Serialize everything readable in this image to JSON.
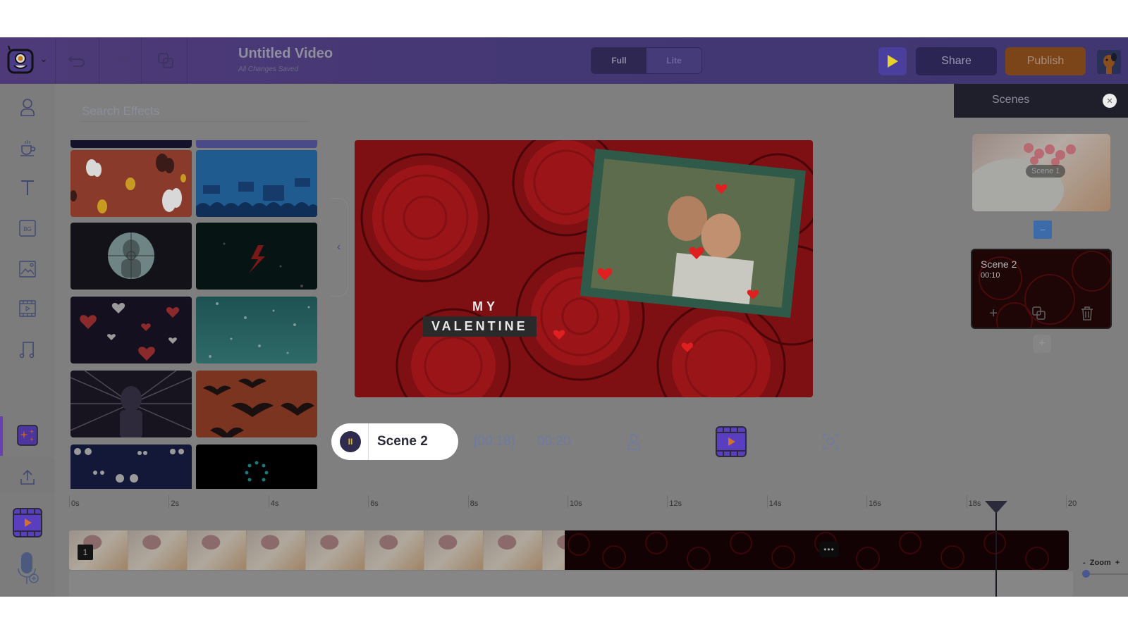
{
  "header": {
    "title": "Untitled Video",
    "subtitle": "All Changes Saved",
    "mode_options": [
      "Full",
      "Lite"
    ],
    "mode_selected": "Full",
    "share_label": "Share",
    "publish_label": "Publish"
  },
  "sidebar": {
    "items": [
      {
        "name": "characters",
        "icon": "character-icon"
      },
      {
        "name": "props",
        "icon": "coffee-cup-icon"
      },
      {
        "name": "text",
        "icon": "text-icon"
      },
      {
        "name": "backgrounds",
        "icon": "bg-icon",
        "glyph": "BG"
      },
      {
        "name": "images",
        "icon": "image-icon"
      },
      {
        "name": "videos",
        "icon": "video-icon"
      },
      {
        "name": "music",
        "icon": "music-icon"
      },
      {
        "name": "effects",
        "icon": "sparkles-icon",
        "active": true
      },
      {
        "name": "upload",
        "icon": "upload-icon"
      },
      {
        "name": "more",
        "icon": "grid-icon"
      }
    ]
  },
  "effects_panel": {
    "search_placeholder": "Search Effects",
    "tiles": [
      {
        "name": "dark-strip",
        "theme": "dark-navy"
      },
      {
        "name": "protest-hands",
        "theme": "purple-crowd"
      },
      {
        "name": "butterflies",
        "theme": "orange-butterflies"
      },
      {
        "name": "protest-crowd",
        "theme": "blue-crowd"
      },
      {
        "name": "scope-target",
        "theme": "dark-scope"
      },
      {
        "name": "lightning",
        "theme": "dark-teal-bolt"
      },
      {
        "name": "hearts",
        "theme": "dark-hearts"
      },
      {
        "name": "snow",
        "theme": "teal-snow"
      },
      {
        "name": "shock-burst",
        "theme": "dark-burst"
      },
      {
        "name": "bats",
        "theme": "orange-bats"
      },
      {
        "name": "eyes",
        "theme": "navy-eyes"
      },
      {
        "name": "loading-spinner",
        "theme": "black-spinner"
      }
    ]
  },
  "canvas": {
    "text_line1": "MY",
    "text_line2": "VALENTINE"
  },
  "player": {
    "scene_label": "Scene 2",
    "current_time": "[00:18]",
    "total_time": "00:20"
  },
  "scenes_panel": {
    "title": "Scenes",
    "scenes": [
      {
        "label": "Scene 1"
      },
      {
        "label": "Scene 2",
        "duration": "00:10"
      }
    ]
  },
  "timeline": {
    "ticks": [
      "0s",
      "2s",
      "4s",
      "6s",
      "8s",
      "10s",
      "12s",
      "14s",
      "16s",
      "18s",
      "20"
    ],
    "scene1_badge": "1",
    "more_label": "•••",
    "zoom_label": "Zoom",
    "zoom_minus": "-",
    "zoom_plus": "+",
    "playhead_seconds": 18.6,
    "zoom_level": 0.0
  },
  "colors": {
    "header_bg": "#4a3a76",
    "publish": "#7b4419",
    "share": "#2b2553",
    "accent_purple": "#6a3fb3",
    "scene_divider": "#3d6aa8"
  }
}
